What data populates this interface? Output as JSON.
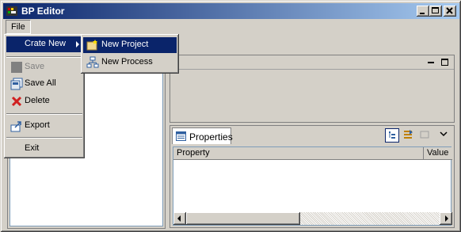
{
  "window": {
    "title": "BP Editor"
  },
  "menubar": {
    "file_label": "File"
  },
  "file_menu": {
    "items": [
      {
        "label": "Crate New",
        "has_submenu": true,
        "selected": true
      },
      {
        "label": "Save",
        "disabled": true,
        "icon": "save-icon"
      },
      {
        "label": "Save All",
        "icon": "save-all-icon"
      },
      {
        "label": "Delete",
        "icon": "delete-icon"
      },
      {
        "label": "Export",
        "icon": "export-icon"
      },
      {
        "label": "Exit"
      }
    ]
  },
  "submenu": {
    "items": [
      {
        "label": "New Project",
        "icon": "new-project-icon",
        "selected": true
      },
      {
        "label": "New Process",
        "icon": "new-process-icon"
      }
    ]
  },
  "properties": {
    "tab_label": "Properties",
    "columns": [
      "Property",
      "Value"
    ]
  },
  "colors": {
    "selection": "#0a246a",
    "titlebar_start": "#0a246a",
    "titlebar_end": "#a6caf0"
  }
}
